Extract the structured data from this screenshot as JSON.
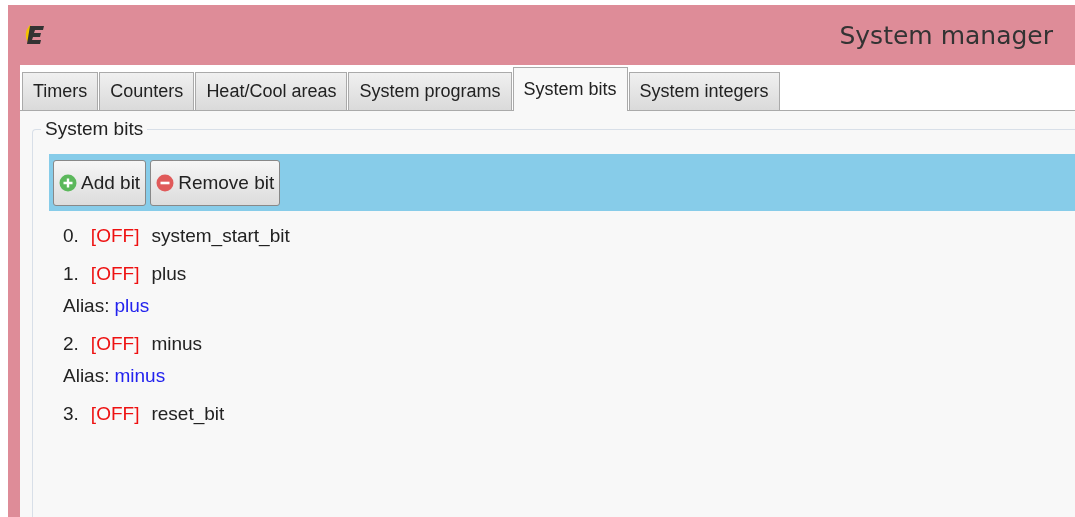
{
  "window": {
    "title": "System manager"
  },
  "tabs": [
    {
      "label": "Timers",
      "selected": false
    },
    {
      "label": "Counters",
      "selected": false
    },
    {
      "label": "Heat/Cool areas",
      "selected": false
    },
    {
      "label": "System programs",
      "selected": false
    },
    {
      "label": "System bits",
      "selected": true
    },
    {
      "label": "System integers",
      "selected": false
    }
  ],
  "group": {
    "title": "System bits"
  },
  "toolbar": [
    {
      "kind": "add",
      "label": "Add bit"
    },
    {
      "kind": "remove",
      "label": "Remove bit"
    }
  ],
  "bits": [
    {
      "index": "0.",
      "state": "[OFF]",
      "on": false,
      "name": "system_start_bit"
    },
    {
      "index": "1.",
      "state": "[OFF]",
      "on": false,
      "name": "plus",
      "alias_label": "Alias:",
      "alias": "plus"
    },
    {
      "index": "2.",
      "state": "[OFF]",
      "on": false,
      "name": "minus",
      "alias_label": "Alias:",
      "alias": "minus"
    },
    {
      "index": "3.",
      "state": "[OFF]",
      "on": false,
      "name": "reset_bit"
    }
  ]
}
